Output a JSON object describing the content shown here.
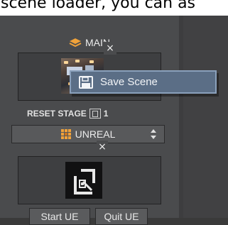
{
  "caption": {
    "text": "scene loader, you can as"
  },
  "panel": {
    "header": {
      "icon": "layers-icon",
      "label": "MAIN"
    },
    "scene_slot": {
      "thumbnail": "scene-thumbnail",
      "close_label": "×"
    },
    "reset": {
      "label": "RESET STAGE",
      "extra": "1"
    },
    "engine_select": {
      "icon": "unreal-grid-icon",
      "value": "UNREAL"
    },
    "unreal_slot": {
      "thumbnail": "unreal-connect-icon",
      "close_label": "×"
    },
    "buttons": {
      "start": "Start UE",
      "quit": "Quit UE"
    }
  },
  "context_menu": {
    "icon": "save-icon",
    "item": "Save Scene"
  },
  "colors": {
    "highlight": "#5b6e86",
    "highlight_border": "#8aa0bb",
    "panel": "#4a4b4d"
  }
}
